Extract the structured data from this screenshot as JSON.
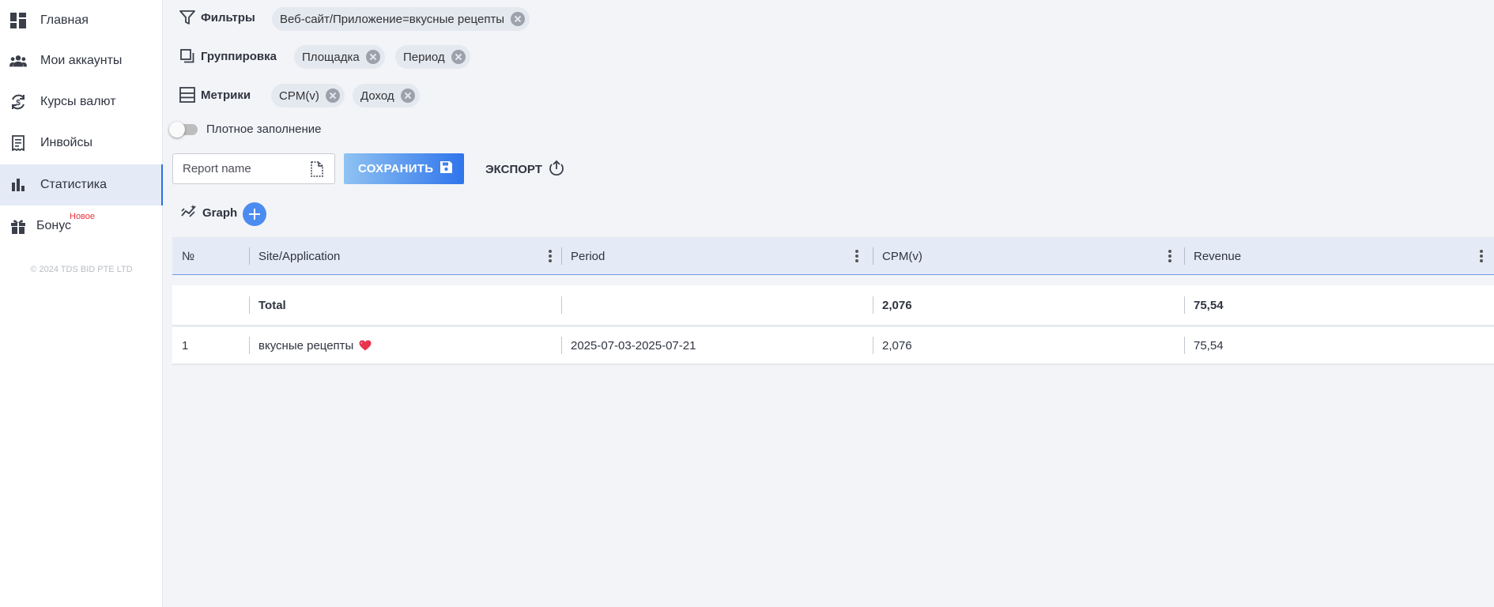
{
  "sidebar": {
    "items": [
      {
        "label": "Главная",
        "icon": "dashboard-icon"
      },
      {
        "label": "Мои аккаунты",
        "icon": "users-icon"
      },
      {
        "label": "Курсы валют",
        "icon": "currency-exchange-icon"
      },
      {
        "label": "Инвойсы",
        "icon": "receipt-icon"
      },
      {
        "label": "Статистика",
        "icon": "bar-chart-icon"
      },
      {
        "label": "Бонус",
        "icon": "gift-icon"
      }
    ],
    "bonus_badge": "Новое",
    "copyright": "© 2024 TDS BID PTE LTD"
  },
  "filters": {
    "label": "Фильтры",
    "chips": [
      "Веб-сайт/Приложение=вкусные рецепты"
    ]
  },
  "grouping": {
    "label": "Группировка",
    "chips": [
      "Площадка",
      "Период"
    ]
  },
  "metrics": {
    "label": "Метрики",
    "chips": [
      "CPM(v)",
      "Доход"
    ]
  },
  "dense_toggle": {
    "label": "Плотное заполнение",
    "on": false
  },
  "report": {
    "placeholder": "Report name",
    "save_label": "СОХРАНИТЬ",
    "export_label": "ЭКСПОРТ"
  },
  "graph": {
    "label": "Graph"
  },
  "table": {
    "columns": [
      "№",
      "Site/Application",
      "Period",
      "CPM(v)",
      "Revenue"
    ],
    "total": {
      "label": "Total",
      "period": "",
      "cpm": "2,076",
      "revenue": "75,54"
    },
    "rows": [
      {
        "num": "1",
        "site": "вкусные рецепты",
        "period": "2025-07-03-2025-07-21",
        "cpm": "2,076",
        "revenue": "75,54"
      }
    ]
  },
  "colors": {
    "accent": "#2f74ec",
    "active_bg": "#e4ebf7",
    "badge": "#e8333d",
    "heart": "#e8334f"
  }
}
